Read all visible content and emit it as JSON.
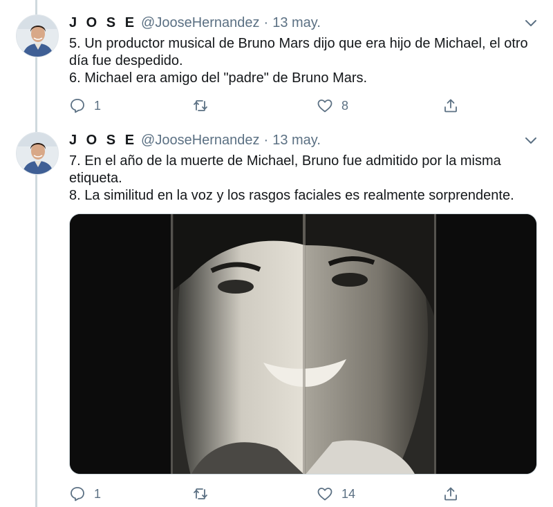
{
  "tweets": [
    {
      "author": {
        "name": "J O S E",
        "handle": "@JooseHernandez",
        "separator": "·",
        "date": "13 may."
      },
      "lines": [
        "5. Un productor musical de Bruno Mars dijo que era hijo de Michael, el otro día fue despedido.",
        "6. Michael era amigo del \"padre\" de Bruno Mars."
      ],
      "replies": "1",
      "retweets": "",
      "likes": "8",
      "icons": {
        "reply": "reply-icon",
        "retweet": "retweet-icon",
        "like": "like-heart-icon",
        "share": "share-icon",
        "menu": "chevron-down-icon"
      }
    },
    {
      "author": {
        "name": "J O S E",
        "handle": "@JooseHernandez",
        "separator": "·",
        "date": "13 may."
      },
      "lines": [
        "7. En el año de la muerte de Michael, Bruno fue admitido por la misma etiqueta.",
        "8. La similitud en la voz y los rasgos faciales es realmente sorprendente."
      ],
      "replies": "1",
      "retweets": "",
      "likes": "14",
      "media": "photo",
      "icons": {
        "reply": "reply-icon",
        "retweet": "retweet-icon",
        "like": "like-heart-icon",
        "share": "share-icon",
        "menu": "chevron-down-icon"
      }
    }
  ],
  "colors": {
    "text": "#14171a",
    "secondary": "#5b7083",
    "thread_line": "#cfd9de",
    "background": "#ffffff"
  }
}
